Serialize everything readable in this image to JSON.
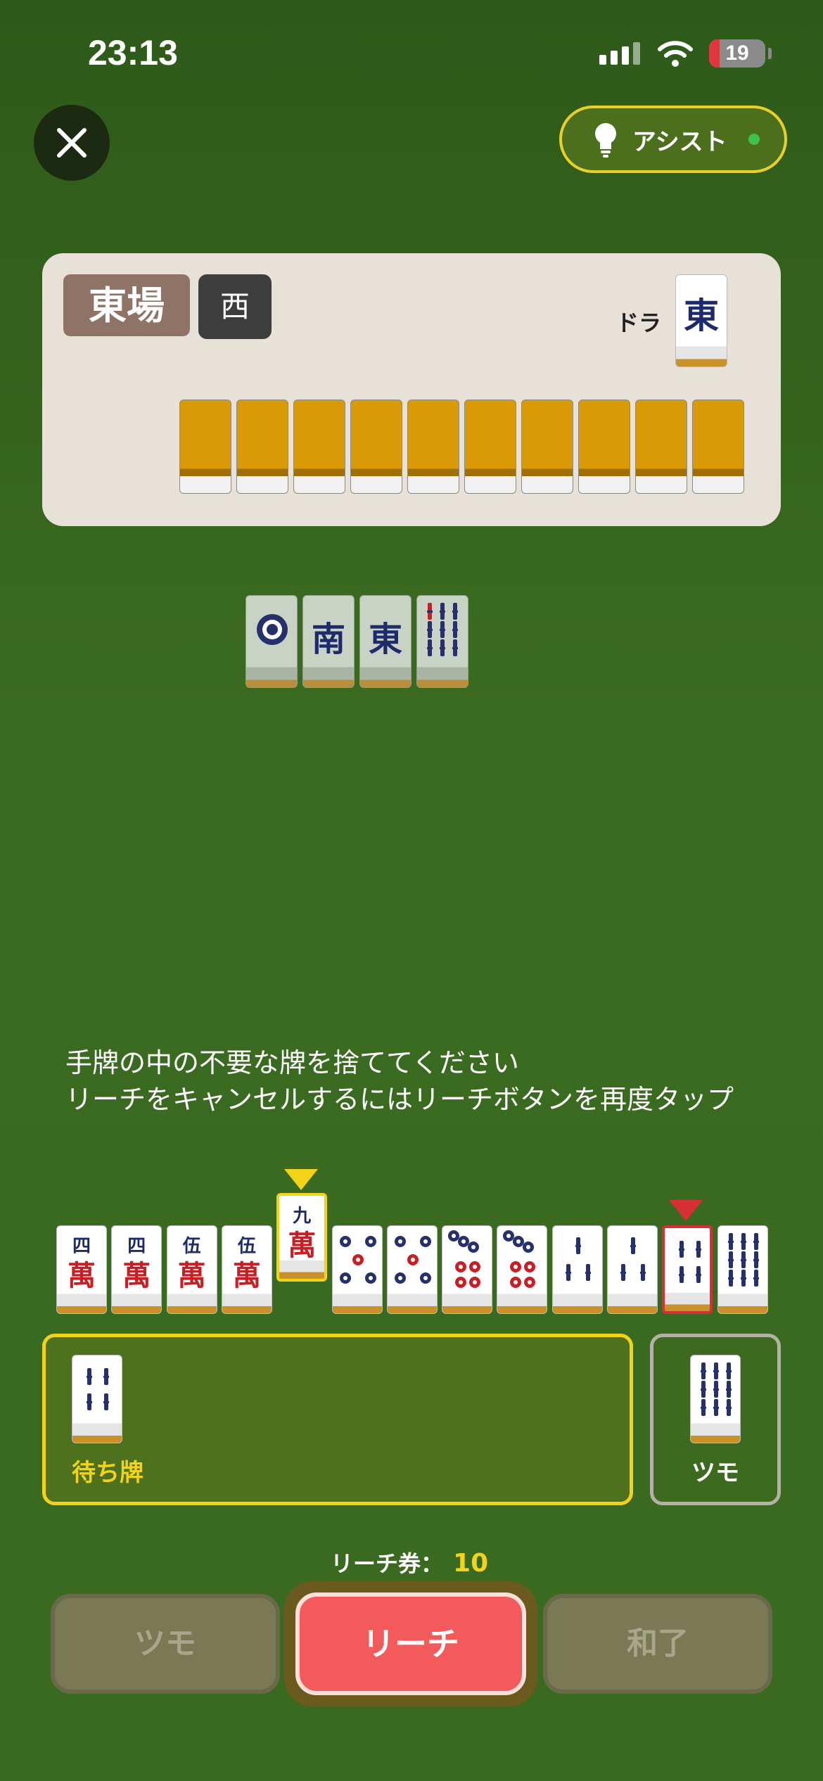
{
  "status_bar": {
    "time": "23:13",
    "battery": "19",
    "battery_level": 0.19
  },
  "header": {
    "assist_label": "アシスト",
    "close_icon": "close-icon",
    "assist_icon": "lightbulb-icon"
  },
  "round_info": {
    "round": "東場",
    "seat": "西",
    "dora_label": "ドラ",
    "dora_tile": "東",
    "hidden_tile_count": 10
  },
  "discards": [
    "1筒",
    "南",
    "東",
    "9索"
  ],
  "instructions": {
    "line1": "手牌の中の不要な牌を捨ててください",
    "line2": "リーチをキャンセルするにはリーチボタンを再度タップ"
  },
  "hand": {
    "tiles": [
      {
        "rank": "四",
        "suit": "萬"
      },
      {
        "rank": "四",
        "suit": "萬"
      },
      {
        "rank": "伍",
        "suit": "萬"
      },
      {
        "rank": "伍",
        "suit": "萬"
      },
      {
        "rank": "九",
        "suit": "萬",
        "state": "selected"
      },
      {
        "rank": "5",
        "suit": "筒"
      },
      {
        "rank": "5",
        "suit": "筒"
      },
      {
        "rank": "7",
        "suit": "筒"
      },
      {
        "rank": "7",
        "suit": "筒"
      },
      {
        "rank": "3",
        "suit": "索"
      },
      {
        "rank": "3",
        "suit": "索"
      },
      {
        "rank": "6",
        "suit": "索",
        "state": "discard-target"
      },
      {
        "rank": "9",
        "suit": "索"
      }
    ]
  },
  "waiting": {
    "label": "待ち牌",
    "tiles": [
      "6索"
    ]
  },
  "drawn": {
    "label": "ツモ",
    "tile": "9索"
  },
  "riichi": {
    "label": "リーチ券：",
    "count": "10"
  },
  "actions": {
    "tsumo": "ツモ",
    "riichi": "リーチ",
    "agari": "和了"
  },
  "colors": {
    "accent_yellow": "#f2d319",
    "riichi_red": "#f25a5c",
    "background_green": "#3b6b20"
  }
}
